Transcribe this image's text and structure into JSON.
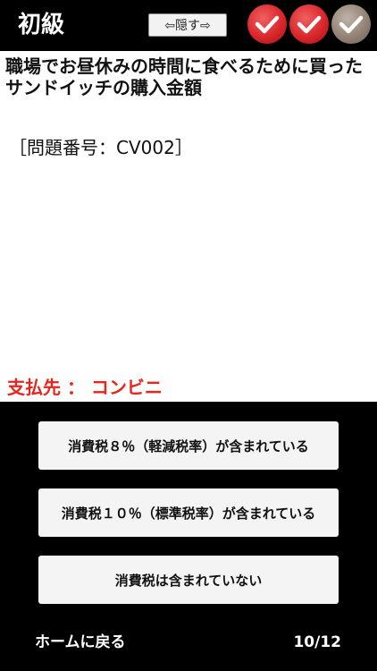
{
  "header": {
    "level": "初級",
    "hide_button": "⇦隠す⇨",
    "results": [
      "correct",
      "correct",
      "pending"
    ]
  },
  "question": {
    "text": "職場でお昼休みの時間に食べるために買ったサンドイッチの購入金額",
    "number_label": "［問題番号：CV002］"
  },
  "payee": "支払先 ： コンビニ",
  "answers": [
    "消費税８％（軽減税率）が含まれている",
    "消費税１０％（標準税率）が含まれている",
    "消費税は含まれていない"
  ],
  "footer": {
    "home": "ホームに戻る",
    "progress": "10/12"
  },
  "colors": {
    "accent_red": "#e8251c",
    "check_red": "#d9262b",
    "check_gray": "#938376"
  }
}
